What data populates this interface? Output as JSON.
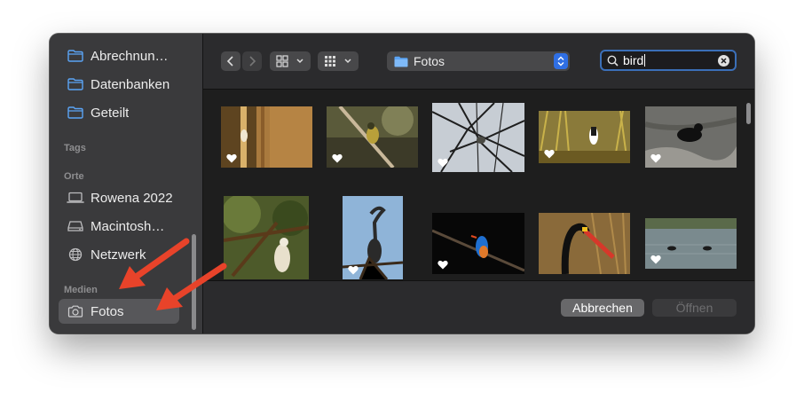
{
  "sidebar": {
    "favorites": [
      {
        "label": "Abrechnun…",
        "icon": "folder-icon"
      },
      {
        "label": "Datenbanken",
        "icon": "folder-icon"
      },
      {
        "label": "Geteilt",
        "icon": "folder-icon"
      }
    ],
    "tags_heading": "Tags",
    "locations_heading": "Orte",
    "locations": [
      {
        "label": "Rowena 2022",
        "icon": "laptop-icon"
      },
      {
        "label": "Macintosh…",
        "icon": "drive-icon"
      },
      {
        "label": "Netzwerk",
        "icon": "globe-icon"
      }
    ],
    "media_heading": "Medien",
    "media": [
      {
        "label": "Fotos",
        "icon": "camera-icon",
        "selected": true
      }
    ]
  },
  "toolbar": {
    "location": "Fotos",
    "search_query": "bird"
  },
  "photos": [
    {
      "subject": "bird on bamboo",
      "favorite": true
    },
    {
      "subject": "bird on branch",
      "favorite": true
    },
    {
      "subject": "bird in bare tree",
      "favorite": true
    },
    {
      "subject": "kingfisher in grass",
      "favorite": true
    },
    {
      "subject": "black bird on rock",
      "favorite": true
    },
    {
      "subject": "vulture in tree",
      "favorite": false
    },
    {
      "subject": "darter on branch",
      "favorite": true
    },
    {
      "subject": "malachite kingfisher",
      "favorite": true
    },
    {
      "subject": "saddle-billed stork",
      "favorite": false
    },
    {
      "subject": "birds on water",
      "favorite": true
    }
  ],
  "footer": {
    "cancel_label": "Abbrechen",
    "open_label": "Öffnen"
  },
  "colors": {
    "accent": "#2f6fe4",
    "annotation_arrow": "#e8432a",
    "folder": "#5ba4f5"
  }
}
